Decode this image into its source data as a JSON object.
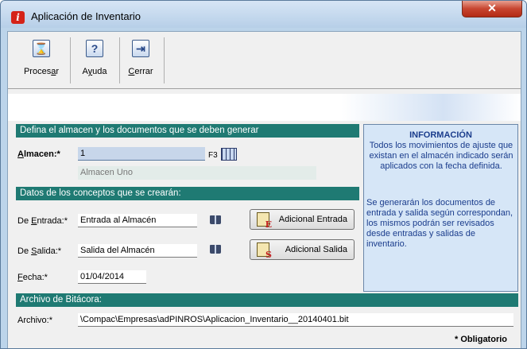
{
  "window": {
    "title": "Aplicación de Inventario",
    "close_glyph": "✕"
  },
  "toolbar": {
    "procesar_pre": "Proces",
    "procesar_key": "a",
    "procesar_post": "r",
    "ayuda_pre": "A",
    "ayuda_key": "y",
    "ayuda_post": "uda",
    "cerrar_key": "C",
    "cerrar_post": "errar"
  },
  "section1": {
    "title": "Defina el almacen y los documentos que se deben generar"
  },
  "almacen": {
    "label_key": "A",
    "label_post": "lmacen:*",
    "value": "1",
    "f3": "F3",
    "name": "Almacen Uno"
  },
  "section2": {
    "title": "Datos de los conceptos que se crearán:"
  },
  "entrada": {
    "label_pre": "De ",
    "label_key": "E",
    "label_post": "ntrada:*",
    "value": "Entrada al Almacén",
    "button": "Adicional Entrada",
    "button_glyph": "E"
  },
  "salida": {
    "label_pre": "De ",
    "label_key": "S",
    "label_post": "alida:*",
    "value": "Salida del Almacén",
    "button": "Adicional Salida",
    "button_glyph": "S"
  },
  "fecha": {
    "label_key": "F",
    "label_post": "echa:*",
    "value": "01/04/2014"
  },
  "section3": {
    "title": "Archivo de Bitácora:"
  },
  "archivo": {
    "label": "Archivo:*",
    "value": "\\Compac\\Empresas\\adPINROS\\Aplicacion_Inventario__20140401.bit"
  },
  "info": {
    "title": "INFORMACIÓN",
    "p1": "Todos los movimientos de ajuste que existan en el almacén indicado serán aplicados con la fecha definida.",
    "p2": "Se generarán los documentos de entrada y salida según correspondan, los mismos podrán ser revisados desde entradas y salidas de inventario."
  },
  "footer": {
    "required": "* Obligatorio"
  },
  "colors": {
    "section_bar": "#1f7a73",
    "info_text": "#1a3c8c",
    "close_button": "#c74530"
  },
  "icons": {
    "procesar": "hourglass-icon",
    "ayuda": "help-icon",
    "cerrar": "exit-icon",
    "lookup": "grid-lookup-icon",
    "book": "book-icon"
  }
}
